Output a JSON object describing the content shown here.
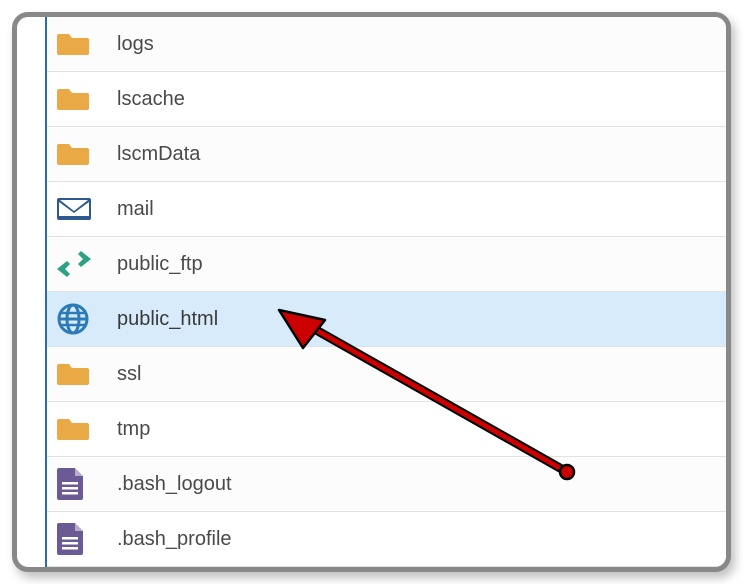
{
  "files": [
    {
      "name": "logs",
      "icon": "folder",
      "selected": false
    },
    {
      "name": "lscache",
      "icon": "folder",
      "selected": false
    },
    {
      "name": "lscmData",
      "icon": "folder",
      "selected": false
    },
    {
      "name": "mail",
      "icon": "mail",
      "selected": false
    },
    {
      "name": "public_ftp",
      "icon": "transfer",
      "selected": false
    },
    {
      "name": "public_html",
      "icon": "globe",
      "selected": true
    },
    {
      "name": "ssl",
      "icon": "folder",
      "selected": false
    },
    {
      "name": "tmp",
      "icon": "folder",
      "selected": false
    },
    {
      "name": ".bash_logout",
      "icon": "doc",
      "selected": false
    },
    {
      "name": ".bash_profile",
      "icon": "doc",
      "selected": false
    }
  ]
}
